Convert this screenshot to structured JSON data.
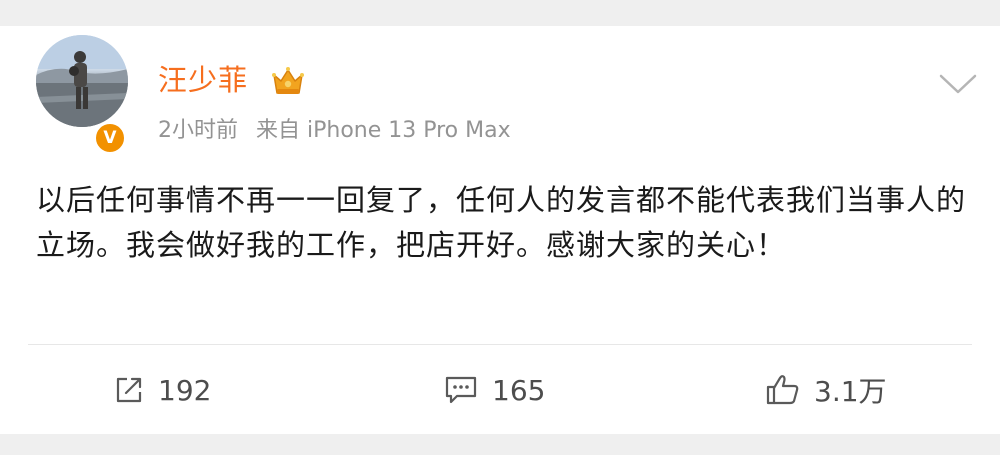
{
  "post": {
    "author": {
      "name": "汪少菲",
      "verified_badge_letter": "V"
    },
    "meta": {
      "time": "2小时前",
      "source": "来自 iPhone 13 Pro Max"
    },
    "content": "以后任何事情不再一一回复了，任何人的发言都不能代表我们当事人的立场。我会做好我的工作，把店开好。感谢大家的关心！",
    "actions": {
      "repost_count": "192",
      "comment_count": "165",
      "like_count": "3.1万"
    }
  },
  "icons": {
    "crown": "crown-icon",
    "more": "chevron-down-icon",
    "repost": "repost-icon",
    "comment": "comment-icon",
    "like": "like-icon"
  },
  "colors": {
    "username": "#f66e1e",
    "badge": "#f29100",
    "meta_text": "#939393",
    "body_text": "#1a1a1a",
    "background": "#efefef"
  }
}
